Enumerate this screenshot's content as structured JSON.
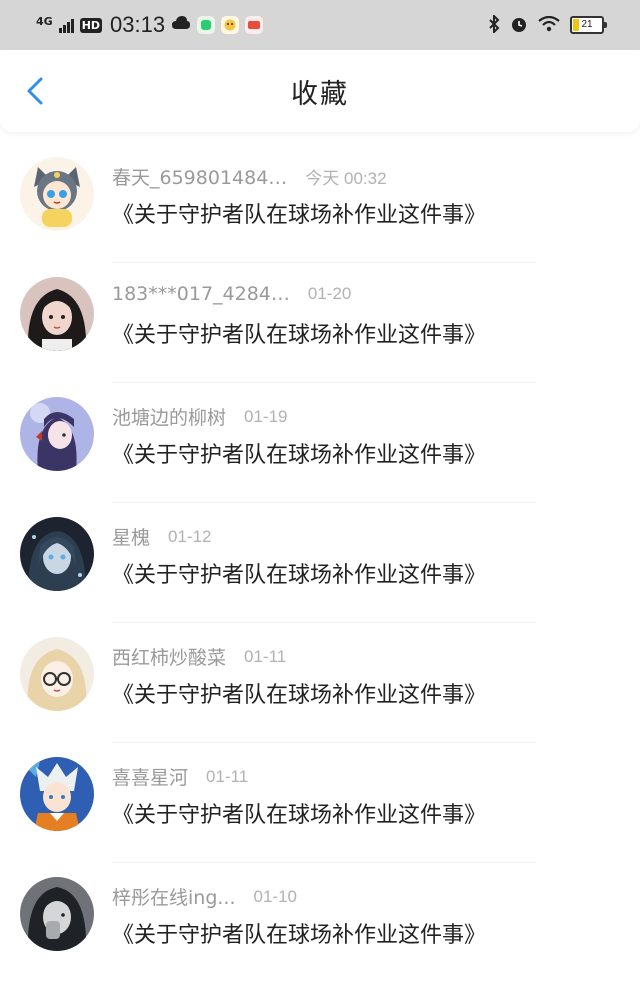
{
  "status_bar": {
    "network": "4G",
    "hd": "HD",
    "time": "03:13",
    "battery": "21",
    "battery_level": 0.21,
    "icons": [
      "signal-icon",
      "cloud-icon",
      "app-icon-green",
      "app-icon-face",
      "app-icon-red",
      "bluetooth-icon",
      "alarm-icon",
      "wifi-icon",
      "battery-icon"
    ]
  },
  "header": {
    "title": "收藏",
    "back_icon": "chevron-left-icon"
  },
  "colors": {
    "accent": "#2f8ef0",
    "status_bar_bg": "#d6d6d6",
    "meta_text": "#9a9a9a",
    "title_text": "#222222"
  },
  "items": [
    {
      "user": "春天_659801484…",
      "date": "今天 00:32",
      "title": "《关于守护者队在球场补作业这件事》",
      "avatar": "cartoon-cat-avatar"
    },
    {
      "user": "183***017_4284…",
      "date": "01-20",
      "title": "《关于守护者队在球场补作业这件事》",
      "avatar": "girl-avatar"
    },
    {
      "user": "池塘边的柳树",
      "date": "01-19",
      "title": "《关于守护者队在球场补作业这件事》",
      "avatar": "anime-girl-braid-avatar"
    },
    {
      "user": "星槐",
      "date": "01-12",
      "title": "《关于守护者队在球场补作业这件事》",
      "avatar": "dark-anime-avatar"
    },
    {
      "user": "西红柿炒酸菜",
      "date": "01-11",
      "title": "《关于守护者队在球场补作业这件事》",
      "avatar": "glasses-girl-avatar"
    },
    {
      "user": "喜喜星河",
      "date": "01-11",
      "title": "《关于守护者队在球场补作业这件事》",
      "avatar": "anime-boy-avatar"
    },
    {
      "user": "梓彤在线ing...",
      "date": "01-10",
      "title": "《关于守护者队在球场补作业这件事》",
      "avatar": "mono-girl-avatar"
    }
  ]
}
